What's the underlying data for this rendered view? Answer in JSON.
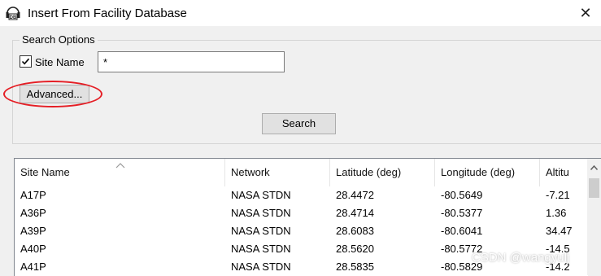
{
  "window": {
    "title": "Insert From Facility Database",
    "close_glyph": "✕"
  },
  "app_icon": {
    "text": "DB"
  },
  "search_options": {
    "group_label": "Search Options",
    "site_name_label": "Site Name",
    "site_name_checked": true,
    "site_name_value": "*",
    "advanced_label": "Advanced...",
    "search_label": "Search"
  },
  "table": {
    "columns": [
      "Site Name",
      "Network",
      "Latitude (deg)",
      "Longitude (deg)",
      "Altitu"
    ],
    "rows": [
      [
        "A17P",
        "NASA STDN",
        "28.4472",
        "-80.5649",
        "-7.21"
      ],
      [
        "A36P",
        "NASA STDN",
        "28.4714",
        "-80.5377",
        "1.36"
      ],
      [
        "A39P",
        "NASA STDN",
        "28.6083",
        "-80.6041",
        "34.47"
      ],
      [
        "A40P",
        "NASA STDN",
        "28.5620",
        "-80.5772",
        "-14.5"
      ],
      [
        "A41P",
        "NASA STDN",
        "28.5835",
        "-80.5829",
        "-14.2"
      ]
    ]
  },
  "watermark": "CSDN @wangyulj",
  "colors": {
    "highlight_ellipse": "#e51e25"
  }
}
